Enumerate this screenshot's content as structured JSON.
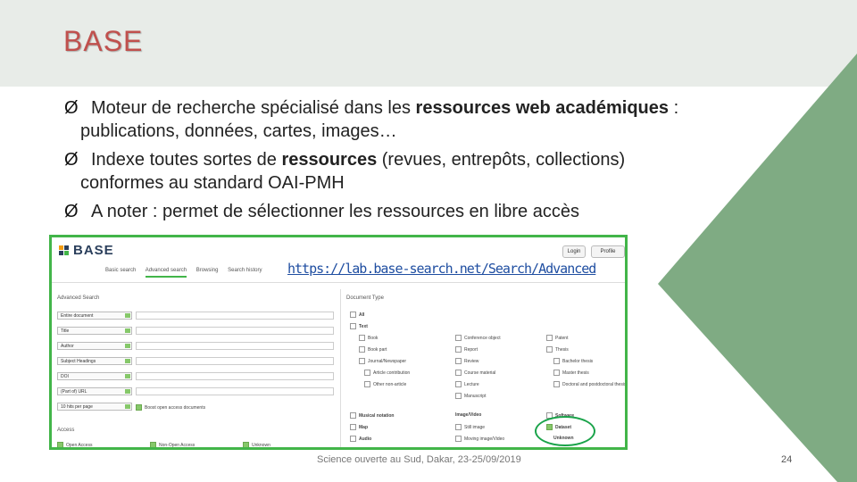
{
  "slide": {
    "title": "BASE",
    "bullets": [
      {
        "plain1": "Moteur de recherche spécialisé dans les ",
        "bold": "ressources web académiques",
        "plain2": " :",
        "line2": "publications, données, cartes, images…"
      },
      {
        "plain1": "Indexe toutes sortes de ",
        "bold": "ressources",
        "plain2": " (revues, entrepôts, collections)",
        "line2": "conformes au standard OAI-PMH"
      },
      {
        "plain1": "A noter : permet de sélectionner les ressources en libre accès",
        "bold": "",
        "plain2": "",
        "line2": ""
      }
    ],
    "bullet_glyph": "Ø",
    "footer": "Science ouverte au Sud, Dakar, 23-25/09/2019",
    "page_number": "24",
    "colors": {
      "title": "#c0504d",
      "header_bg": "#e8ece8",
      "triangle": "#7fab83",
      "frame": "#42b549",
      "link": "#1f4ea1"
    }
  },
  "screenshot": {
    "logo": "BASE",
    "login": "Login",
    "right_btn": "Profile",
    "nav": [
      "Basic search",
      "Advanced search",
      "Browsing",
      "Search history"
    ],
    "url": "https://lab.base-search.net/Search/Advanced",
    "advanced_search_label": "Advanced Search",
    "fields": [
      "Entire document",
      "Title",
      "Author",
      "Subject Headings",
      "DOI",
      "(Part of) URL",
      "10 hits per page"
    ],
    "exact_open": "Boost open access documents",
    "access_label": "Access",
    "access_options": [
      "Open Access",
      "Non-Open Access",
      "Unknown"
    ],
    "doc_type_label": "Document Type",
    "all": "All",
    "text": "Text",
    "col1": [
      "Book",
      "Book part",
      "Journal/Newspaper",
      "Article contribution",
      "Other non-article"
    ],
    "col2": [
      "Conference object",
      "Report",
      "Review",
      "Course material",
      "Lecture",
      "Manuscript"
    ],
    "col3": [
      "Patent",
      "Thesis",
      "Bachelor thesis",
      "Master thesis",
      "Doctoral and postdoctoral thesis"
    ],
    "bottom_col1": [
      "Musical notation",
      "Map",
      "Audio"
    ],
    "bottom_col2": [
      "Image/Video",
      "Still image",
      "Moving image/Video"
    ],
    "bottom_col3": [
      "Software",
      "Dataset",
      "Unknown"
    ]
  }
}
